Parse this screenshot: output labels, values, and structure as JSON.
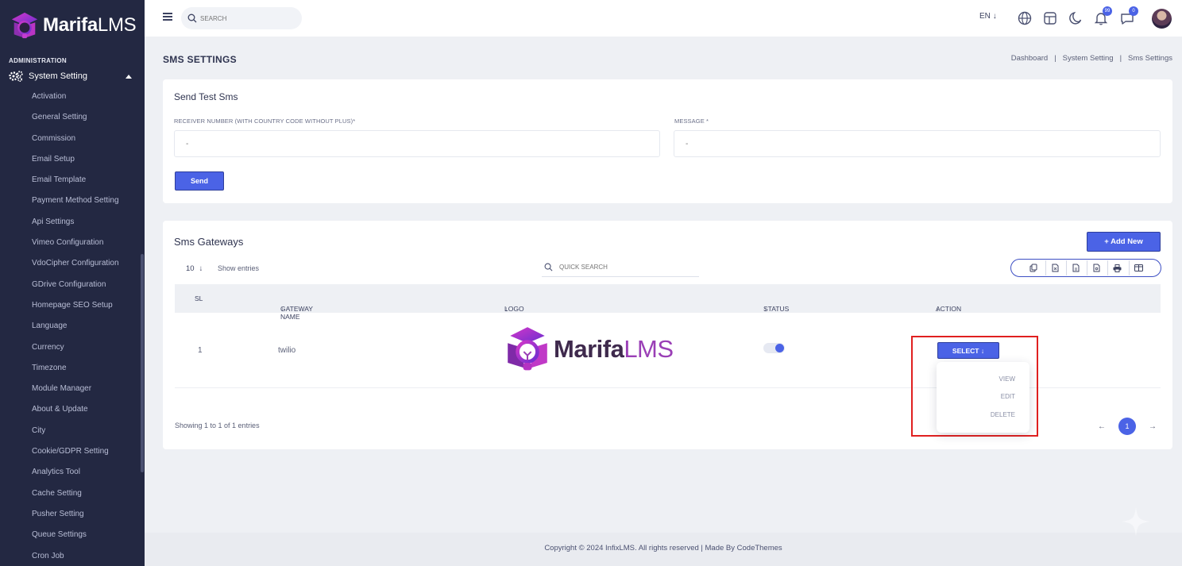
{
  "app": {
    "brand_name_bold": "Marifa",
    "brand_name_light": "LMS"
  },
  "sidebar": {
    "section_label": "ADMINISTRATION",
    "group_label": "System Setting",
    "items": [
      "Activation",
      "General Setting",
      "Commission",
      "Email Setup",
      "Email Template",
      "Payment Method Setting",
      "Api Settings",
      "Vimeo Configuration",
      "VdoCipher Configuration",
      "GDrive Configuration",
      "Homepage SEO Setup",
      "Language",
      "Currency",
      "Timezone",
      "Module Manager",
      "About & Update",
      "City",
      "Cookie/GDPR Setting",
      "Analytics Tool",
      "Cache Setting",
      "Pusher Setting",
      "Queue Settings",
      "Cron Job"
    ]
  },
  "topbar": {
    "search_placeholder": "SEARCH",
    "language": "EN",
    "notification_count": "99",
    "message_count": "0"
  },
  "page": {
    "title": "SMS SETTINGS",
    "breadcrumb": [
      "Dashboard",
      "System Setting",
      "Sms Settings"
    ],
    "breadcrumb_sep": "|"
  },
  "test_sms": {
    "title": "Send Test Sms",
    "receiver_label": "RECEIVER NUMBER (WITH COUNTRY CODE WITHOUT PLUS)*",
    "receiver_placeholder": "-",
    "message_label": "MESSAGE *",
    "message_placeholder": "-",
    "send_label": "Send"
  },
  "gateways": {
    "title": "Sms Gateways",
    "add_new_label": "+ Add New",
    "entries_value": "10",
    "entries_text": "Show entries",
    "quick_search_placeholder": "QUICK SEARCH",
    "columns": [
      "SL",
      "GATEWAY NAME",
      "LOGO",
      "STATUS",
      "ACTION"
    ],
    "rows": [
      {
        "sl": "1",
        "gateway_name": "twilio",
        "logo_bold": "Marifa",
        "logo_light": "LMS",
        "status": true
      }
    ],
    "select_label": "SELECT",
    "actions": [
      "VIEW",
      "EDIT",
      "DELETE"
    ],
    "showing_text": "Showing 1 to 1 of 1 entries",
    "current_page": "1"
  },
  "footer": {
    "text": "Copyright © 2024 InfixLMS. All rights reserved | Made By CodeThemes"
  },
  "colors": {
    "sidebar_bg": "#232842",
    "accent": "#4b63e6",
    "highlight": "#e02020"
  }
}
